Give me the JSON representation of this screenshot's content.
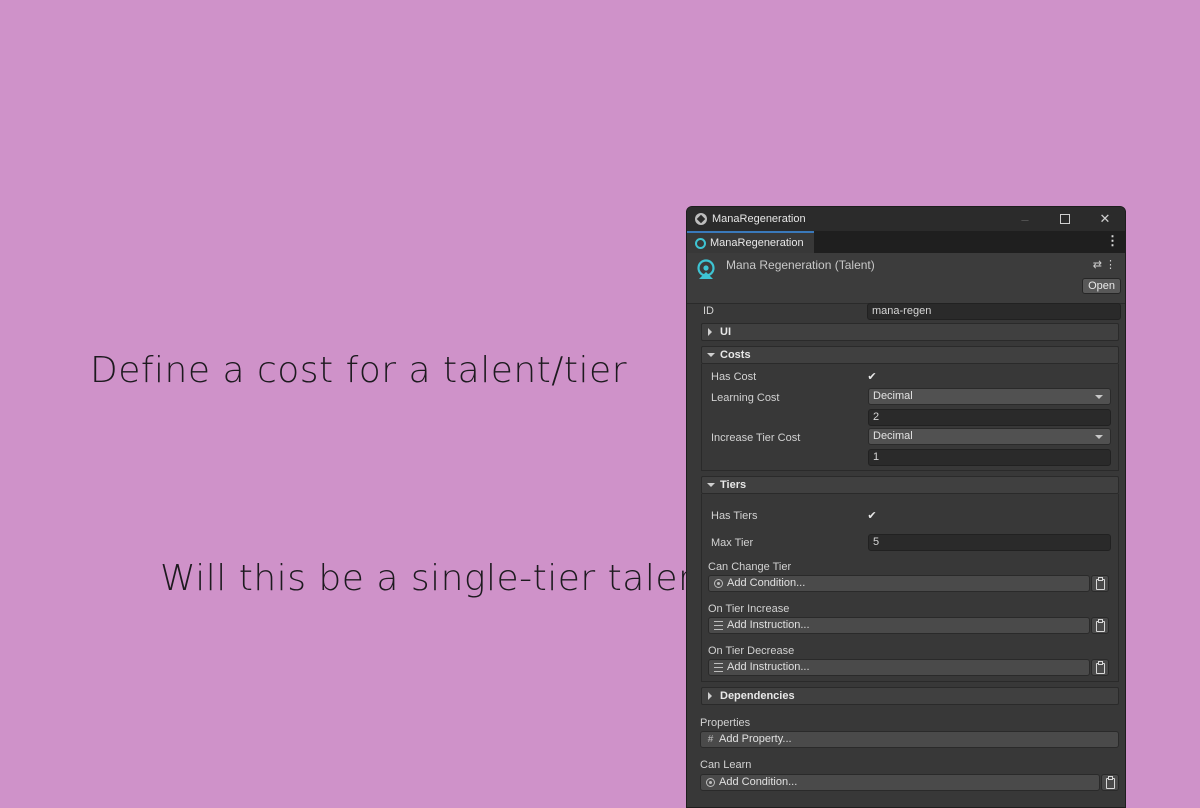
{
  "captions": {
    "cost": "Define a cost for a talent/tier",
    "tier": "Will this be a single-tier talent?"
  },
  "window": {
    "title": "ManaRegeneration",
    "tab_label": "ManaRegeneration",
    "header_title": "Mana Regeneration (Talent)",
    "open_label": "Open",
    "accent_color": "#3ec4d3"
  },
  "fields": {
    "id_label": "ID",
    "id_value": "mana-regen"
  },
  "sections": {
    "ui": "UI",
    "costs": "Costs",
    "tiers": "Tiers",
    "dependencies": "Dependencies"
  },
  "costs": {
    "has_cost_label": "Has Cost",
    "has_cost_checked": true,
    "learning_cost_label": "Learning Cost",
    "learning_cost_type": "Decimal",
    "learning_cost_value": "2",
    "increase_tier_cost_label": "Increase Tier Cost",
    "increase_tier_cost_type": "Decimal",
    "increase_tier_cost_value": "1"
  },
  "tiers": {
    "has_tiers_label": "Has Tiers",
    "has_tiers_checked": true,
    "max_tier_label": "Max Tier",
    "max_tier_value": "5",
    "can_change_tier_label": "Can Change Tier",
    "can_change_tier_action": "Add Condition...",
    "on_tier_increase_label": "On Tier Increase",
    "on_tier_increase_action": "Add Instruction...",
    "on_tier_decrease_label": "On Tier Decrease",
    "on_tier_decrease_action": "Add Instruction..."
  },
  "properties": {
    "label": "Properties",
    "action": "Add Property..."
  },
  "can_learn": {
    "label": "Can Learn",
    "action": "Add Condition..."
  },
  "icons": {
    "check": "✔"
  }
}
